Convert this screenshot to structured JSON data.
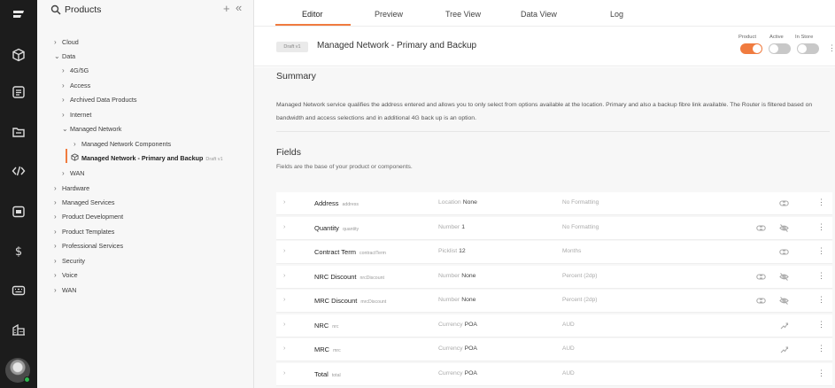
{
  "rail": {
    "icons": [
      "brand-logo-icon",
      "cube-icon",
      "list-icon",
      "folder-icon",
      "code-icon",
      "calendar-icon",
      "dollar-icon",
      "keyboard-icon",
      "building-icon"
    ]
  },
  "tree": {
    "title": "Products",
    "plus": "+",
    "collapse": "«",
    "items": [
      {
        "label": "Cloud",
        "chev": "›"
      },
      {
        "label": "Data",
        "chev": "⌄"
      },
      {
        "label": "4G/5G",
        "chev": "›"
      },
      {
        "label": "Access",
        "chev": "›"
      },
      {
        "label": "Archived Data Products",
        "chev": "›"
      },
      {
        "label": "Internet",
        "chev": "›"
      },
      {
        "label": "Managed Network",
        "chev": "⌄"
      },
      {
        "label": "Managed Network Components",
        "chev": "›"
      },
      {
        "label": "Managed Network - Primary and Backup",
        "draft": "Draft v1"
      },
      {
        "label": "WAN",
        "chev": "›"
      },
      {
        "label": "Hardware",
        "chev": "›"
      },
      {
        "label": "Managed Services",
        "chev": "›"
      },
      {
        "label": "Product Development",
        "chev": "›"
      },
      {
        "label": "Product Templates",
        "chev": "›"
      },
      {
        "label": "Professional Services",
        "chev": "›"
      },
      {
        "label": "Security",
        "chev": "›"
      },
      {
        "label": "Voice",
        "chev": "›"
      },
      {
        "label": "WAN",
        "chev": "›"
      }
    ]
  },
  "tabs": [
    "Editor",
    "Preview",
    "Tree View",
    "Data View",
    "Log"
  ],
  "product": {
    "badge": "Draft v1",
    "title": "Managed Network - Primary and Backup",
    "toggles": [
      {
        "label": "Product",
        "on": true
      },
      {
        "label": "Active",
        "on": false
      },
      {
        "label": "In Store",
        "on": false
      }
    ],
    "kebab": "⋮"
  },
  "summary": {
    "heading": "Summary",
    "text": "Managed Network service qualifies the address entered and allows you to only select from options available at the location. Primary and also a backup fibre link available. The Router is filtered based on bandwidth and access selections and in additional 4G back up is an option."
  },
  "fields": {
    "heading": "Fields",
    "subtitle": "Fields are the base of your product or components.",
    "chev": "›",
    "kebab": "⋮",
    "rows": [
      {
        "name": "Address",
        "key": "address",
        "type": "Location",
        "value": "None",
        "format": "No Formatting",
        "icons": [
          "link-icon"
        ]
      },
      {
        "name": "Quantity",
        "key": "quantity",
        "type": "Number",
        "value": "1",
        "format": "No Formatting",
        "icons": [
          "link-icon",
          "eye-off-icon"
        ]
      },
      {
        "name": "Contract Term",
        "key": "contractTerm",
        "type": "Picklist",
        "value": "12",
        "format": "Months",
        "icons": [
          "link-icon"
        ]
      },
      {
        "name": "NRC Discount",
        "key": "nrcDiscount",
        "type": "Number",
        "value": "None",
        "format": "Percent (2dp)",
        "icons": [
          "link-icon",
          "eye-off-icon"
        ]
      },
      {
        "name": "MRC Discount",
        "key": "mrcDiscount",
        "type": "Number",
        "value": "None",
        "format": "Percent (2dp)",
        "icons": [
          "link-icon",
          "eye-off-icon"
        ]
      },
      {
        "name": "NRC",
        "key": "nrc",
        "type": "Currency",
        "value": "POA",
        "format": "AUD",
        "icons": [
          "formula-icon"
        ]
      },
      {
        "name": "MRC",
        "key": "mrc",
        "type": "Currency",
        "value": "POA",
        "format": "AUD",
        "icons": [
          "formula-icon"
        ]
      },
      {
        "name": "Total",
        "key": "total",
        "type": "Currency",
        "value": "POA",
        "format": "AUD",
        "icons": []
      }
    ]
  },
  "colors": {
    "accent": "#f07b3f",
    "toggle_off": "#c8c8c8",
    "online": "#2fb84f"
  }
}
